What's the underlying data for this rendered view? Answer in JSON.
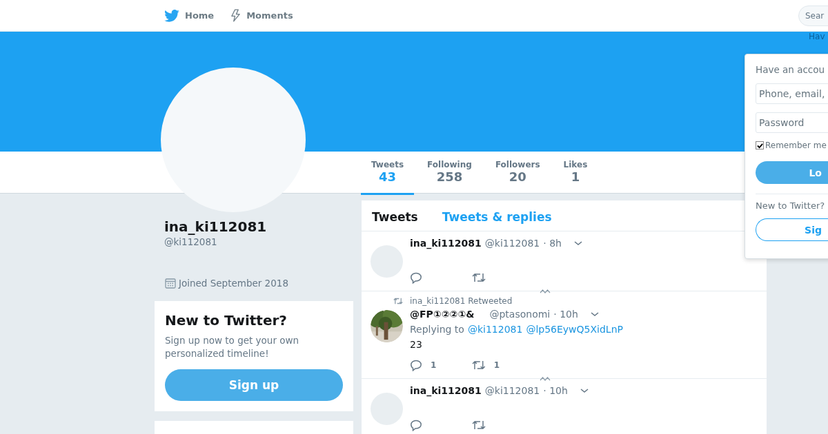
{
  "nav": {
    "items": [
      {
        "label": "Home"
      },
      {
        "label": "Moments"
      }
    ],
    "search": {
      "placeholder": "Sear"
    },
    "hint": "Hav"
  },
  "profile": {
    "name": "ina_ki112081",
    "handle": "@ki112081",
    "joined": "Joined September 2018"
  },
  "stats": [
    {
      "label": "Tweets",
      "value": "43",
      "selected": true
    },
    {
      "label": "Following",
      "value": "258",
      "selected": false
    },
    {
      "label": "Followers",
      "value": "20",
      "selected": false
    },
    {
      "label": "Likes",
      "value": "1",
      "selected": false
    }
  ],
  "signup_card": {
    "title": "New to Twitter?",
    "text": "Sign up now to get your own personalized timeline!",
    "button": "Sign up"
  },
  "timeline": {
    "tabs": [
      {
        "label": "Tweets",
        "selected": true
      },
      {
        "label": "Tweets & replies",
        "selected": false
      }
    ],
    "tweets": [
      {
        "name": "ina_ki112081",
        "handle": "@ki112081",
        "time": "· 8h"
      },
      {
        "avatar": {
          "kind": "picture"
        },
        "retweeted_by": "ina_ki112081 Retweeted",
        "name": "@FP①②②①&",
        "handle": "@ptasonomi",
        "time": "· 10h",
        "reply_prefix": "Replying to",
        "mentions": [
          "@ki112081",
          "@lp56EywQ5XidLnP"
        ],
        "text": "23",
        "replies": "1",
        "retweets": "1"
      },
      {
        "name": "ina_ki112081",
        "handle": "@ki112081",
        "time": "· 10h"
      }
    ]
  },
  "login": {
    "title": "Have an accou",
    "username_placeholder": "Phone, email,",
    "password_placeholder": "Password",
    "remember": "Remember me",
    "remember_checked": true,
    "login_button": "Lo",
    "new_prompt": "New to Twitter?",
    "signup_button": "Sig"
  }
}
